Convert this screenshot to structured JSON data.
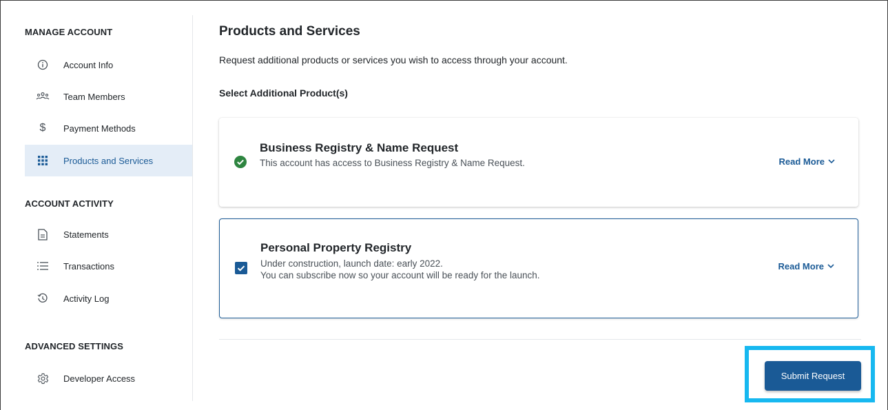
{
  "sidebar": {
    "sections": [
      {
        "title": "MANAGE ACCOUNT"
      },
      {
        "title": "ACCOUNT ACTIVITY"
      },
      {
        "title": "ADVANCED SETTINGS"
      }
    ],
    "items": [
      {
        "label": "Account Info",
        "icon": "info-icon"
      },
      {
        "label": "Team Members",
        "icon": "team-icon"
      },
      {
        "label": "Payment Methods",
        "icon": "dollar-icon"
      },
      {
        "label": "Products and Services",
        "icon": "grid-icon",
        "active": true
      },
      {
        "label": "Statements",
        "icon": "document-icon"
      },
      {
        "label": "Transactions",
        "icon": "list-icon"
      },
      {
        "label": "Activity Log",
        "icon": "history-icon"
      },
      {
        "label": "Developer Access",
        "icon": "gear-icon"
      }
    ]
  },
  "main": {
    "title": "Products and Services",
    "description": "Request additional products or services you wish to access through your account.",
    "select_label": "Select Additional Product(s)",
    "products": [
      {
        "title": "Business Registry & Name Request",
        "description_lines": [
          "This account has access to Business Registry & Name Request."
        ],
        "status": "active",
        "read_more": "Read More"
      },
      {
        "title": "Personal Property Registry",
        "description_lines": [
          "Under construction, launch date: early 2022.",
          "You can subscribe now so your account will be ready for the launch."
        ],
        "status": "checked",
        "read_more": "Read More"
      }
    ],
    "submit_label": "Submit Request"
  },
  "colors": {
    "primary": "#1a5a96",
    "active_bg": "#e4edf7",
    "success": "#2e8540",
    "highlight": "#17b8f0"
  }
}
